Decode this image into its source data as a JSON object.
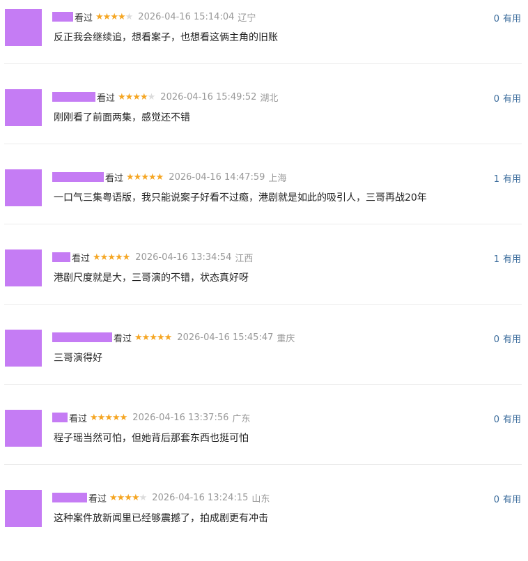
{
  "colors": {
    "star": "#f5a623",
    "star_off": "#dcdcdc",
    "link": "#3a6b9b",
    "meta": "#999999",
    "redaction": "#c57cf4"
  },
  "reviews": [
    {
      "status": "看过",
      "rating": 4,
      "time": "2026-04-16 15:14:04",
      "location": "辽宁",
      "comment": "反正我会继续追，想看案子，也想看这俩主角的旧账",
      "votes": "0",
      "vote_label": "有用"
    },
    {
      "status": "看过",
      "rating": 4,
      "time": "2026-04-16 15:49:52",
      "location": "湖北",
      "comment": "刚刚看了前面两集，感觉还不错",
      "votes": "0",
      "vote_label": "有用"
    },
    {
      "status": "看过",
      "rating": 5,
      "time": "2026-04-16 14:47:59",
      "location": "上海",
      "comment": "一口气三集粤语版，我只能说案子好看不过瘾，港剧就是如此的吸引人，三哥再战20年",
      "votes": "1",
      "vote_label": "有用"
    },
    {
      "status": "看过",
      "rating": 5,
      "time": "2026-04-16 13:34:54",
      "location": "江西",
      "comment": "港剧尺度就是大，三哥演的不错，状态真好呀",
      "votes": "1",
      "vote_label": "有用"
    },
    {
      "status": "看过",
      "rating": 5,
      "time": "2026-04-16 15:45:47",
      "location": "重庆",
      "comment": "三哥演得好",
      "votes": "0",
      "vote_label": "有用"
    },
    {
      "status": "看过",
      "rating": 5,
      "time": "2026-04-16 13:37:56",
      "location": "广东",
      "comment": "程子瑶当然可怕，但她背后那套东西也挺可怕",
      "votes": "0",
      "vote_label": "有用"
    },
    {
      "status": "看过",
      "rating": 4,
      "time": "2026-04-16 13:24:15",
      "location": "山东",
      "comment": "这种案件放新闻里已经够震撼了，拍成剧更有冲击",
      "votes": "0",
      "vote_label": "有用"
    }
  ]
}
